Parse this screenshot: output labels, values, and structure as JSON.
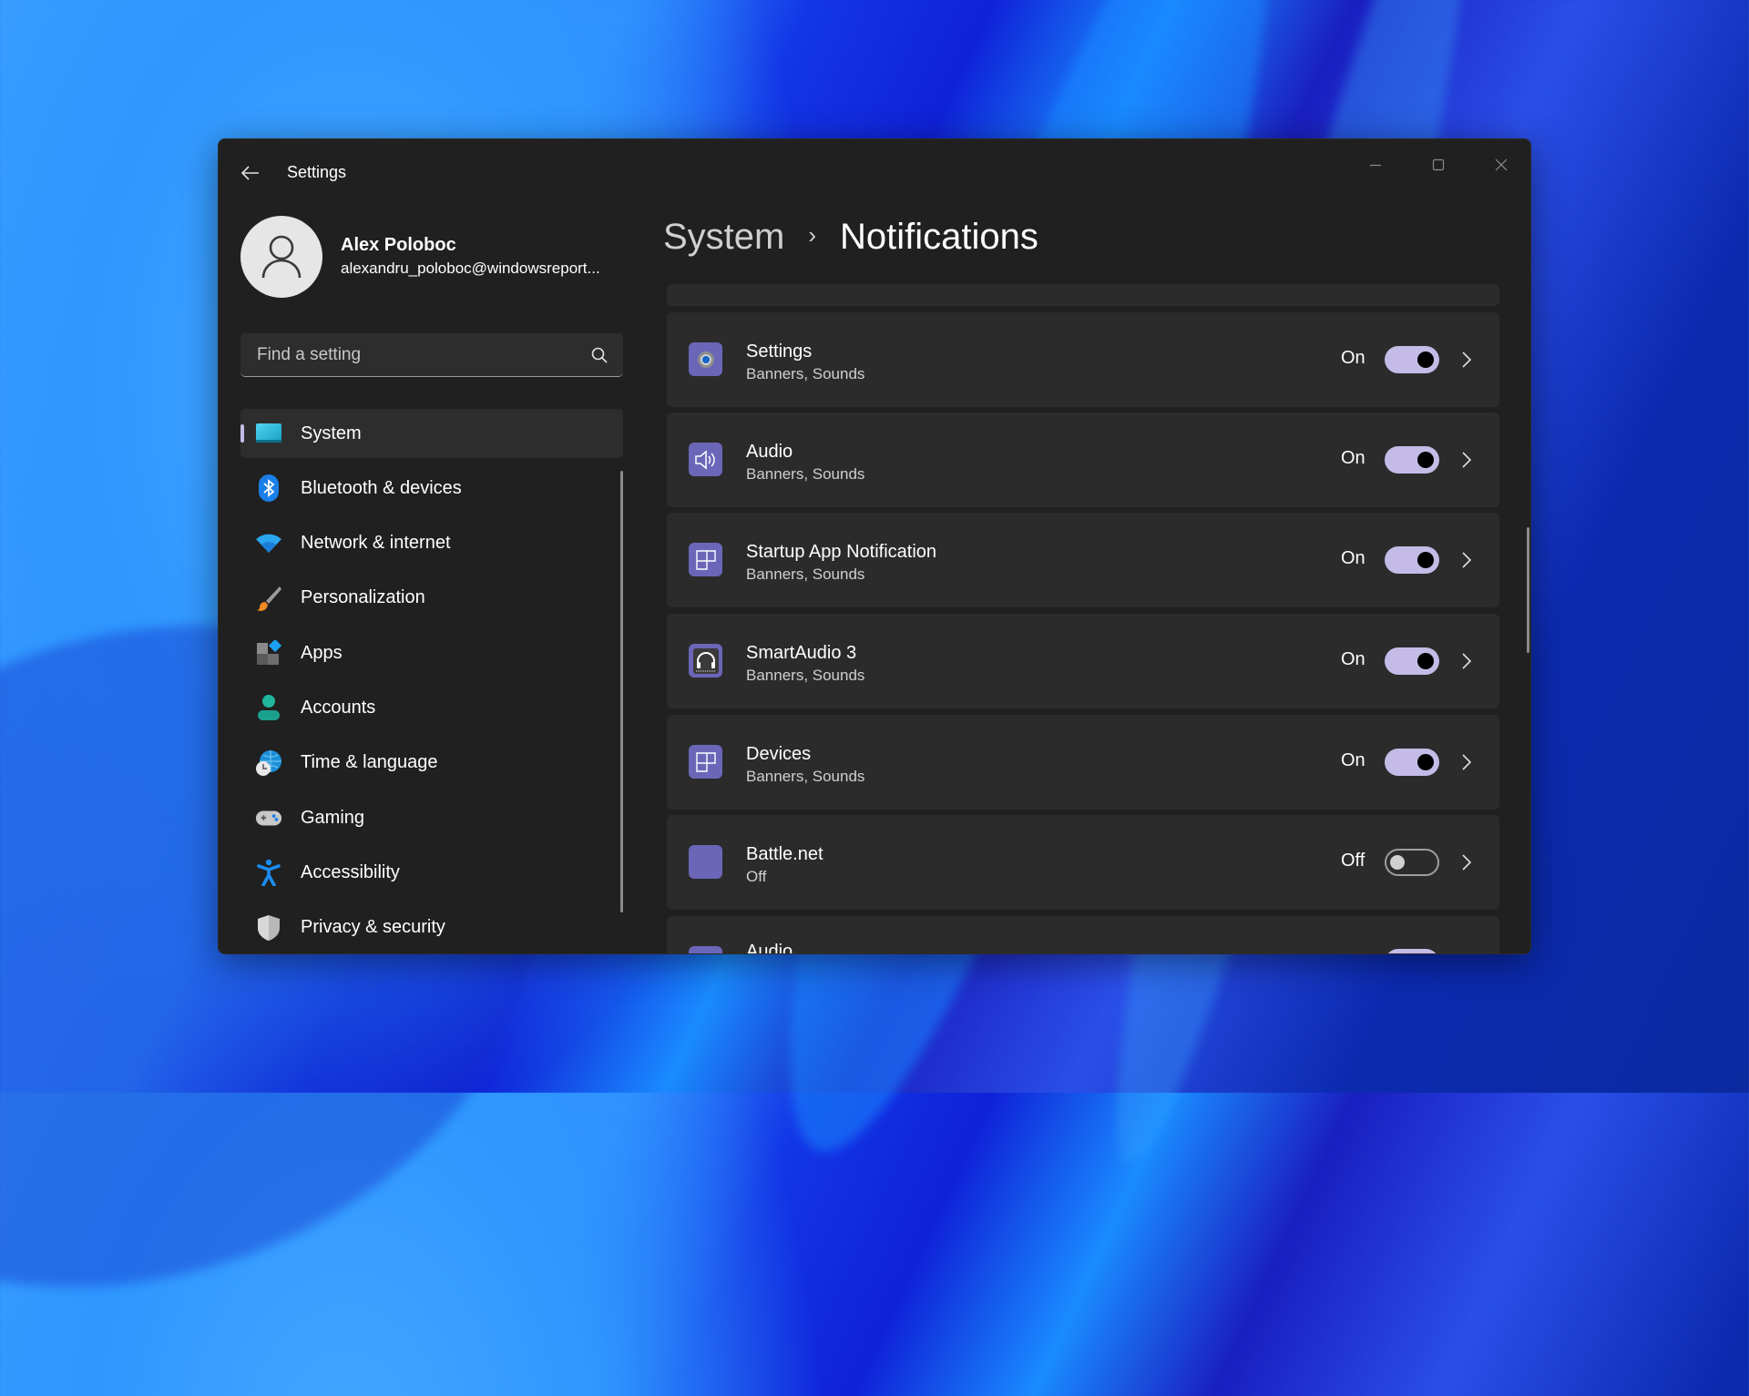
{
  "window": {
    "app_title": "Settings",
    "controls": {
      "minimize": "minimize-icon",
      "maximize": "maximize-icon",
      "close": "close-icon"
    }
  },
  "profile": {
    "name": "Alex Poloboc",
    "email": "alexandru_poloboc@windowsreport..."
  },
  "search": {
    "placeholder": "Find a setting",
    "value": ""
  },
  "sidebar": {
    "items": [
      {
        "label": "System",
        "icon": "monitor-icon",
        "selected": true
      },
      {
        "label": "Bluetooth & devices",
        "icon": "bluetooth-icon",
        "selected": false
      },
      {
        "label": "Network & internet",
        "icon": "wifi-icon",
        "selected": false
      },
      {
        "label": "Personalization",
        "icon": "paintbrush-icon",
        "selected": false
      },
      {
        "label": "Apps",
        "icon": "apps-icon",
        "selected": false
      },
      {
        "label": "Accounts",
        "icon": "person-icon",
        "selected": false
      },
      {
        "label": "Time & language",
        "icon": "globe-clock-icon",
        "selected": false
      },
      {
        "label": "Gaming",
        "icon": "gamepad-icon",
        "selected": false
      },
      {
        "label": "Accessibility",
        "icon": "accessibility-icon",
        "selected": false
      },
      {
        "label": "Privacy & security",
        "icon": "shield-icon",
        "selected": false
      }
    ]
  },
  "header": {
    "parent": "System",
    "separator": "›",
    "current": "Notifications"
  },
  "colors": {
    "accent": "#c4bbe6",
    "window_bg": "#202020",
    "card_bg": "#2b2b2b",
    "app_icon_bg": "#6b66b8"
  },
  "notifications": {
    "apps": [
      {
        "name": "Settings",
        "detail": "Banners, Sounds",
        "state": "On",
        "enabled": true,
        "icon": "gear-icon"
      },
      {
        "name": "Audio",
        "detail": "Banners, Sounds",
        "state": "On",
        "enabled": true,
        "icon": "speaker-icon"
      },
      {
        "name": "Startup App Notification",
        "detail": "Banners, Sounds",
        "state": "On",
        "enabled": true,
        "icon": "grid-icon"
      },
      {
        "name": "SmartAudio 3",
        "detail": "Banners, Sounds",
        "state": "On",
        "enabled": true,
        "icon": "headphones-icon"
      },
      {
        "name": "Devices",
        "detail": "Banners, Sounds",
        "state": "On",
        "enabled": true,
        "icon": "grid-icon"
      },
      {
        "name": "Battle.net",
        "detail": "Off",
        "state": "Off",
        "enabled": false,
        "icon": "blank-app-icon"
      },
      {
        "name": "Audio",
        "detail": "",
        "state": "",
        "enabled": true,
        "icon": "speaker-icon"
      }
    ]
  }
}
